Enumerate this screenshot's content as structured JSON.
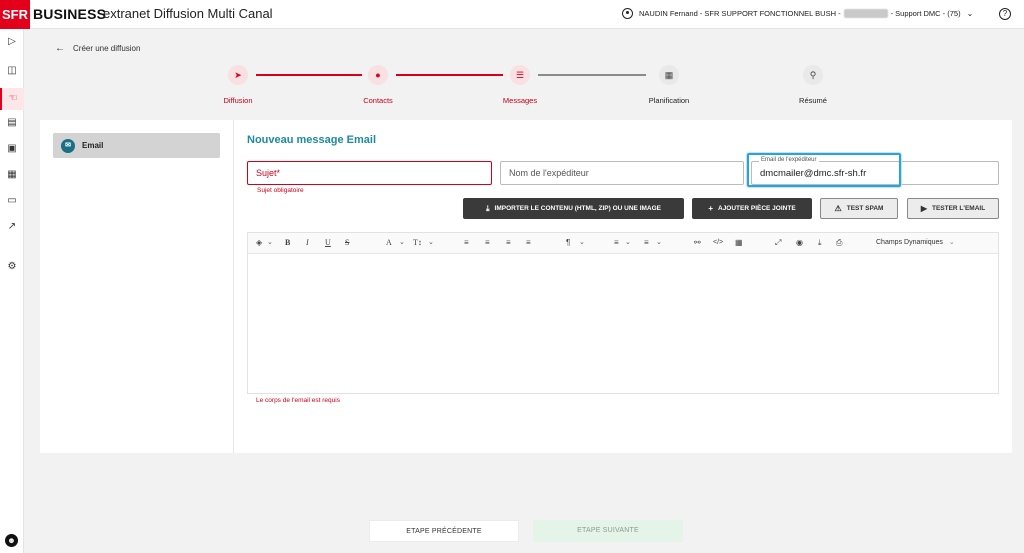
{
  "header": {
    "logo": "SFR",
    "brand": "BUSINESS",
    "app_title": "extranet Diffusion Multi Canal",
    "user_prefix": "NAUDIN Fernand - SFR SUPPORT FONCTIONNEL BUSH -",
    "user_suffix": "- Support DMC - (75)",
    "help": "?"
  },
  "breadcrumb": {
    "back_label": "Créer une diffusion"
  },
  "stepper": {
    "steps": [
      {
        "label": "Diffusion",
        "state": "done",
        "icon": "megaphone-icon"
      },
      {
        "label": "Contacts",
        "state": "done",
        "icon": "users-icon"
      },
      {
        "label": "Messages",
        "state": "current",
        "icon": "message-icon"
      },
      {
        "label": "Planification",
        "state": "todo",
        "icon": "calendar-icon"
      },
      {
        "label": "Résumé",
        "state": "todo",
        "icon": "summary-icon"
      }
    ]
  },
  "sidebar": {
    "items": [
      {
        "label": "Email",
        "icon": "email-icon"
      }
    ]
  },
  "form": {
    "title": "Nouveau message Email",
    "subject_placeholder": "Sujet*",
    "subject_error": "Sujet obligatoire",
    "sender_name_placeholder": "Nom de l'expéditeur",
    "sender_email_label": "Email de l'expéditeur",
    "sender_email_value": "dmcmailer@dmc.sfr-sh.fr",
    "body_error": "Le corps de l'email est requis"
  },
  "actions": {
    "import": "IMPORTER LE CONTENU (HTML, ZIP) OU UNE IMAGE",
    "attach": "AJOUTER PIÈCE JOINTE",
    "spam": "TEST SPAM",
    "test_email": "TESTER L'EMAIL"
  },
  "editor": {
    "dynamic_fields": "Champs Dynamiques"
  },
  "footer": {
    "prev": "ETAPE PRÉCÉDENTE",
    "next": "ETAPE SUIVANTE"
  },
  "colors": {
    "brand_red": "#e2001a",
    "title_teal": "#1e8aa0",
    "focus_blue": "#2aa3d6",
    "error_red": "#d0021b"
  }
}
